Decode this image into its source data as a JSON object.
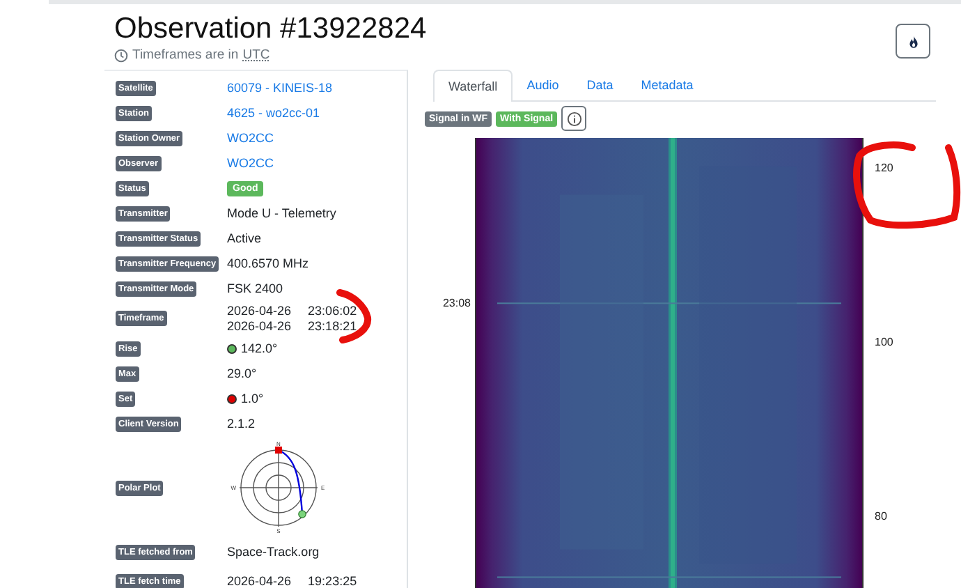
{
  "header": {
    "title": "Observation #13922824",
    "subtitle": "Timeframes are in",
    "subtitle_link": "UTC"
  },
  "details": [
    {
      "label": "Satellite",
      "kind": "link",
      "value": "60079 - KINEIS-18"
    },
    {
      "label": "Station",
      "kind": "link",
      "value": "4625 - wo2cc-01"
    },
    {
      "label": "Station Owner",
      "kind": "link",
      "value": "WO2CC"
    },
    {
      "label": "Observer",
      "kind": "link",
      "value": "WO2CC"
    },
    {
      "label": "Status",
      "kind": "badge",
      "value": "Good"
    },
    {
      "label": "Transmitter",
      "kind": "text",
      "value": "Mode U - Telemetry"
    },
    {
      "label": "Transmitter Status",
      "kind": "text",
      "value": "Active"
    },
    {
      "label": "Transmitter Frequency",
      "kind": "text",
      "value": "400.6570 MHz"
    },
    {
      "label": "Transmitter Mode",
      "kind": "text",
      "value": "FSK 2400"
    },
    {
      "label": "Timeframe",
      "kind": "datetimes",
      "lines": [
        {
          "date": "2026-04-26",
          "time": "23:06:02"
        },
        {
          "date": "2026-04-26",
          "time": "23:18:21"
        }
      ]
    },
    {
      "label": "Rise",
      "kind": "marker",
      "color": "#5cb85c",
      "value": "142.0°"
    },
    {
      "label": "Max",
      "kind": "text",
      "value": "29.0°"
    },
    {
      "label": "Set",
      "kind": "marker",
      "color": "#dd0000",
      "value": "1.0°"
    },
    {
      "label": "Client Version",
      "kind": "text",
      "value": "2.1.2"
    },
    {
      "label": "Polar Plot",
      "kind": "plot",
      "labels": [
        "N",
        "E",
        "S",
        "W"
      ]
    },
    {
      "label": "TLE fetched from",
      "kind": "text",
      "value": "Space-Track.org"
    },
    {
      "label": "TLE fetch time",
      "kind": "datetimes",
      "lines": [
        {
          "date": "2026-04-26",
          "time": "19:23:25"
        }
      ]
    }
  ],
  "tabs": [
    {
      "label": "Waterfall",
      "selected": true
    },
    {
      "label": "Audio",
      "selected": false
    },
    {
      "label": "Data",
      "selected": false
    },
    {
      "label": "Metadata",
      "selected": false
    }
  ],
  "tags": [
    {
      "label": "Signal in WF",
      "color": "#6c757d"
    },
    {
      "label": "With Signal",
      "color": "#5cb85c"
    }
  ],
  "waterfall": {
    "time_ticks": [
      "23:08"
    ],
    "freq_ticks": [
      "120",
      "100",
      "80"
    ]
  }
}
